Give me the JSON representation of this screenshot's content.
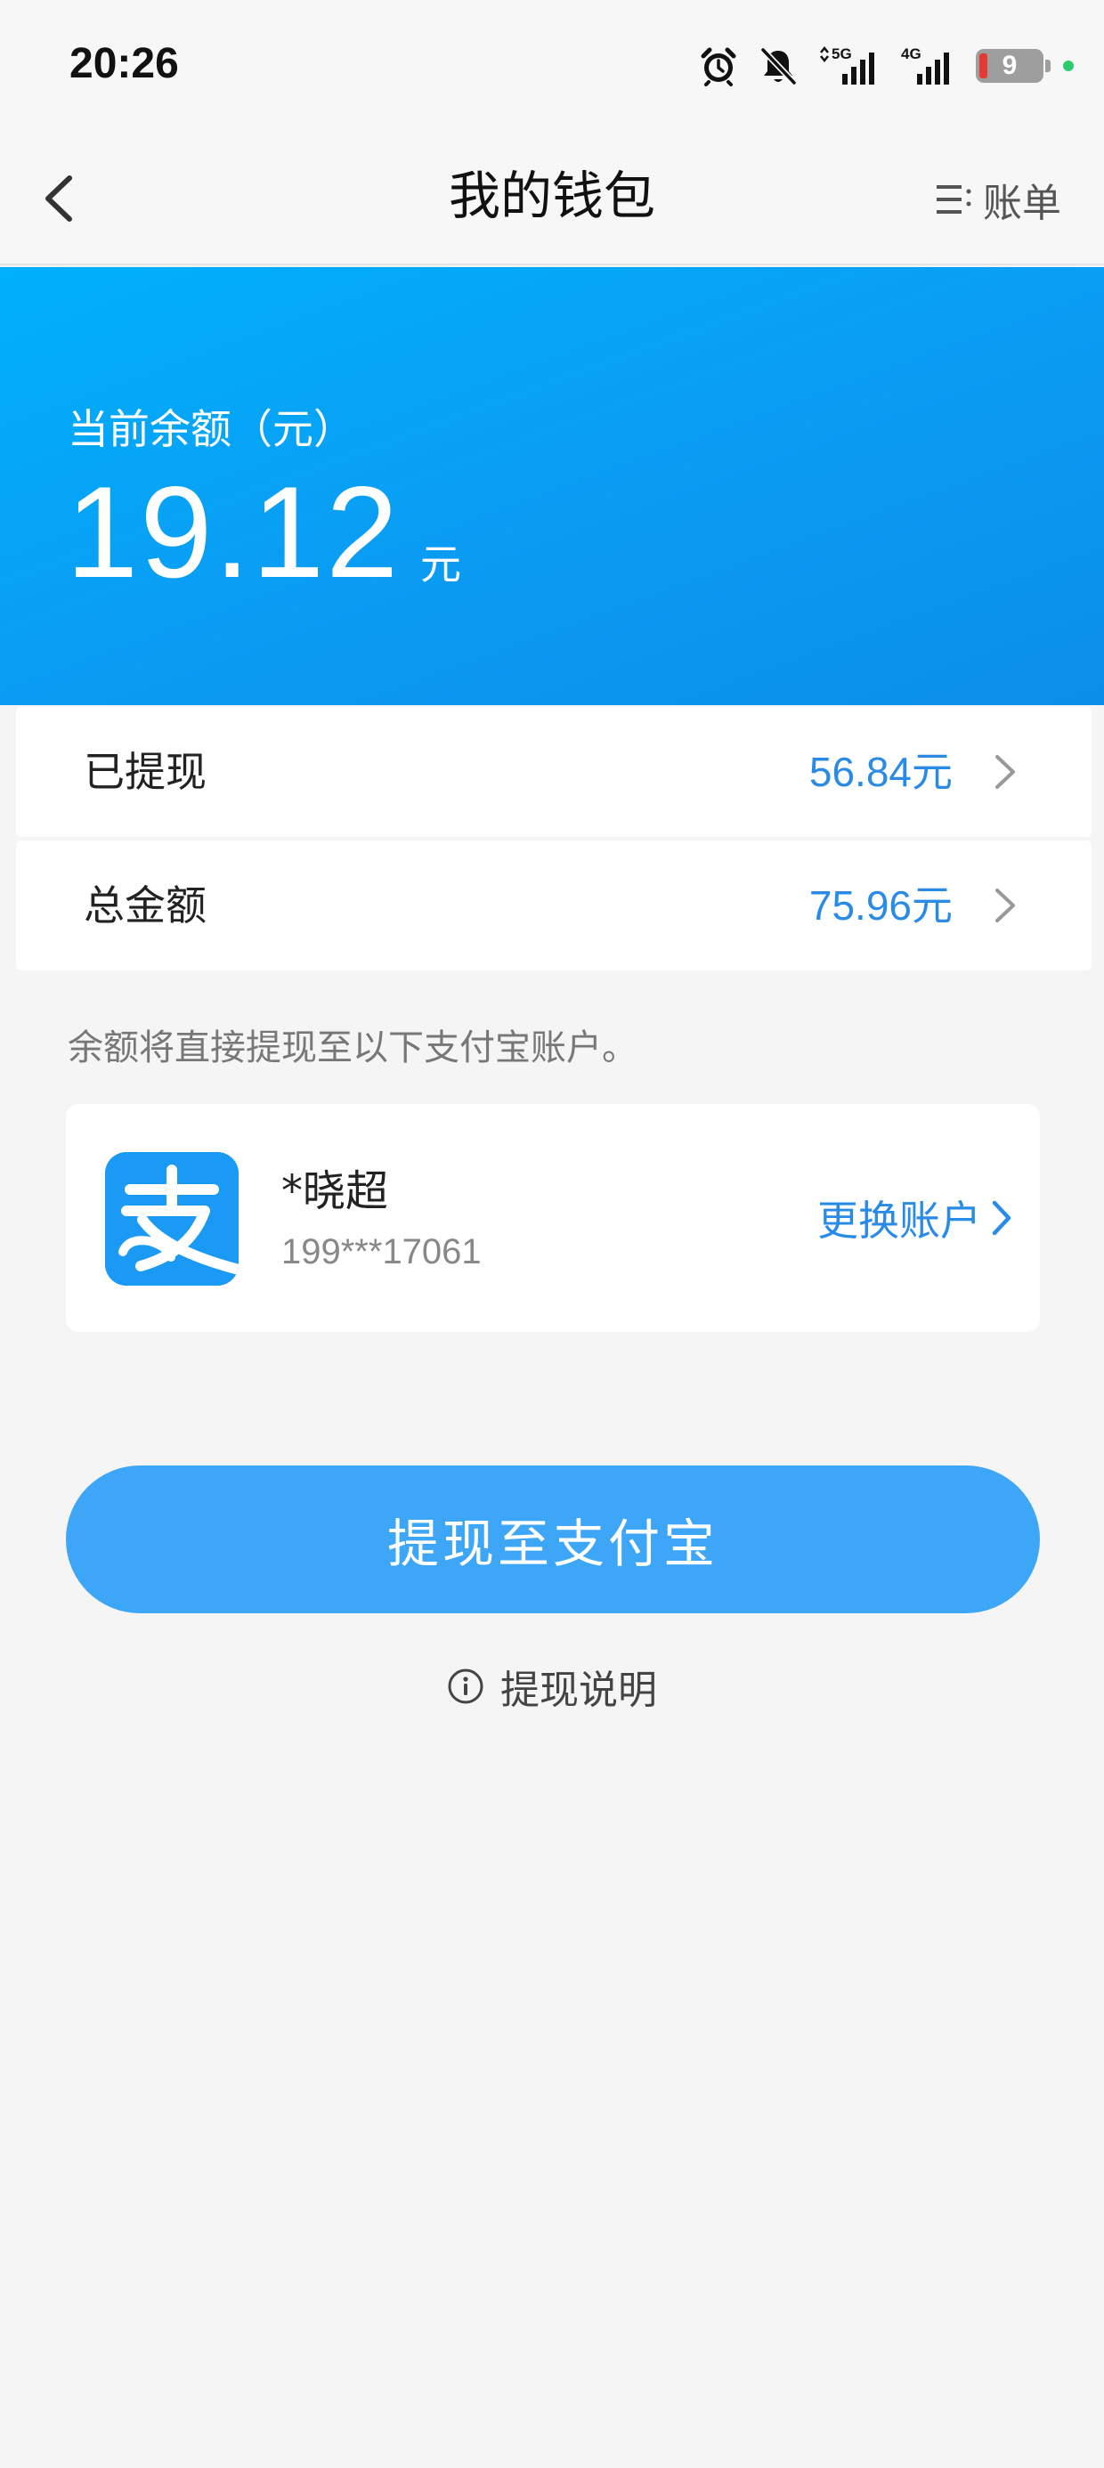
{
  "status_bar": {
    "time": "20:26",
    "network_1": "5G",
    "network_2": "4G",
    "battery_level": "9",
    "icons": [
      "alarm-icon",
      "bell-muted-icon",
      "signal-5g-icon",
      "signal-4g-icon",
      "battery-icon"
    ]
  },
  "nav": {
    "title": "我的钱包",
    "bill_label": "账单",
    "back_icon": "chevron-left-icon",
    "bill_icon": "list-icon"
  },
  "balance": {
    "label": "当前余额（元）",
    "value": "19.12",
    "unit": "元"
  },
  "summary": {
    "withdrawn": {
      "label": "已提现",
      "value": "56.84",
      "unit": "元"
    },
    "total": {
      "label": "总金额",
      "value": "75.96",
      "unit": "元"
    }
  },
  "hint": "余额将直接提现至以下支付宝账户。",
  "account": {
    "name": "*晓超",
    "phone": "199***17061",
    "change_label": "更换账户",
    "logo_icon": "alipay-logo-icon"
  },
  "actions": {
    "withdraw_label": "提现至支付宝",
    "note_label": "提现说明"
  },
  "colors": {
    "banner": "#0b9bf3",
    "accent_text": "#2a8be6",
    "button": "#3ea6f6",
    "background": "#f5f5f5"
  }
}
